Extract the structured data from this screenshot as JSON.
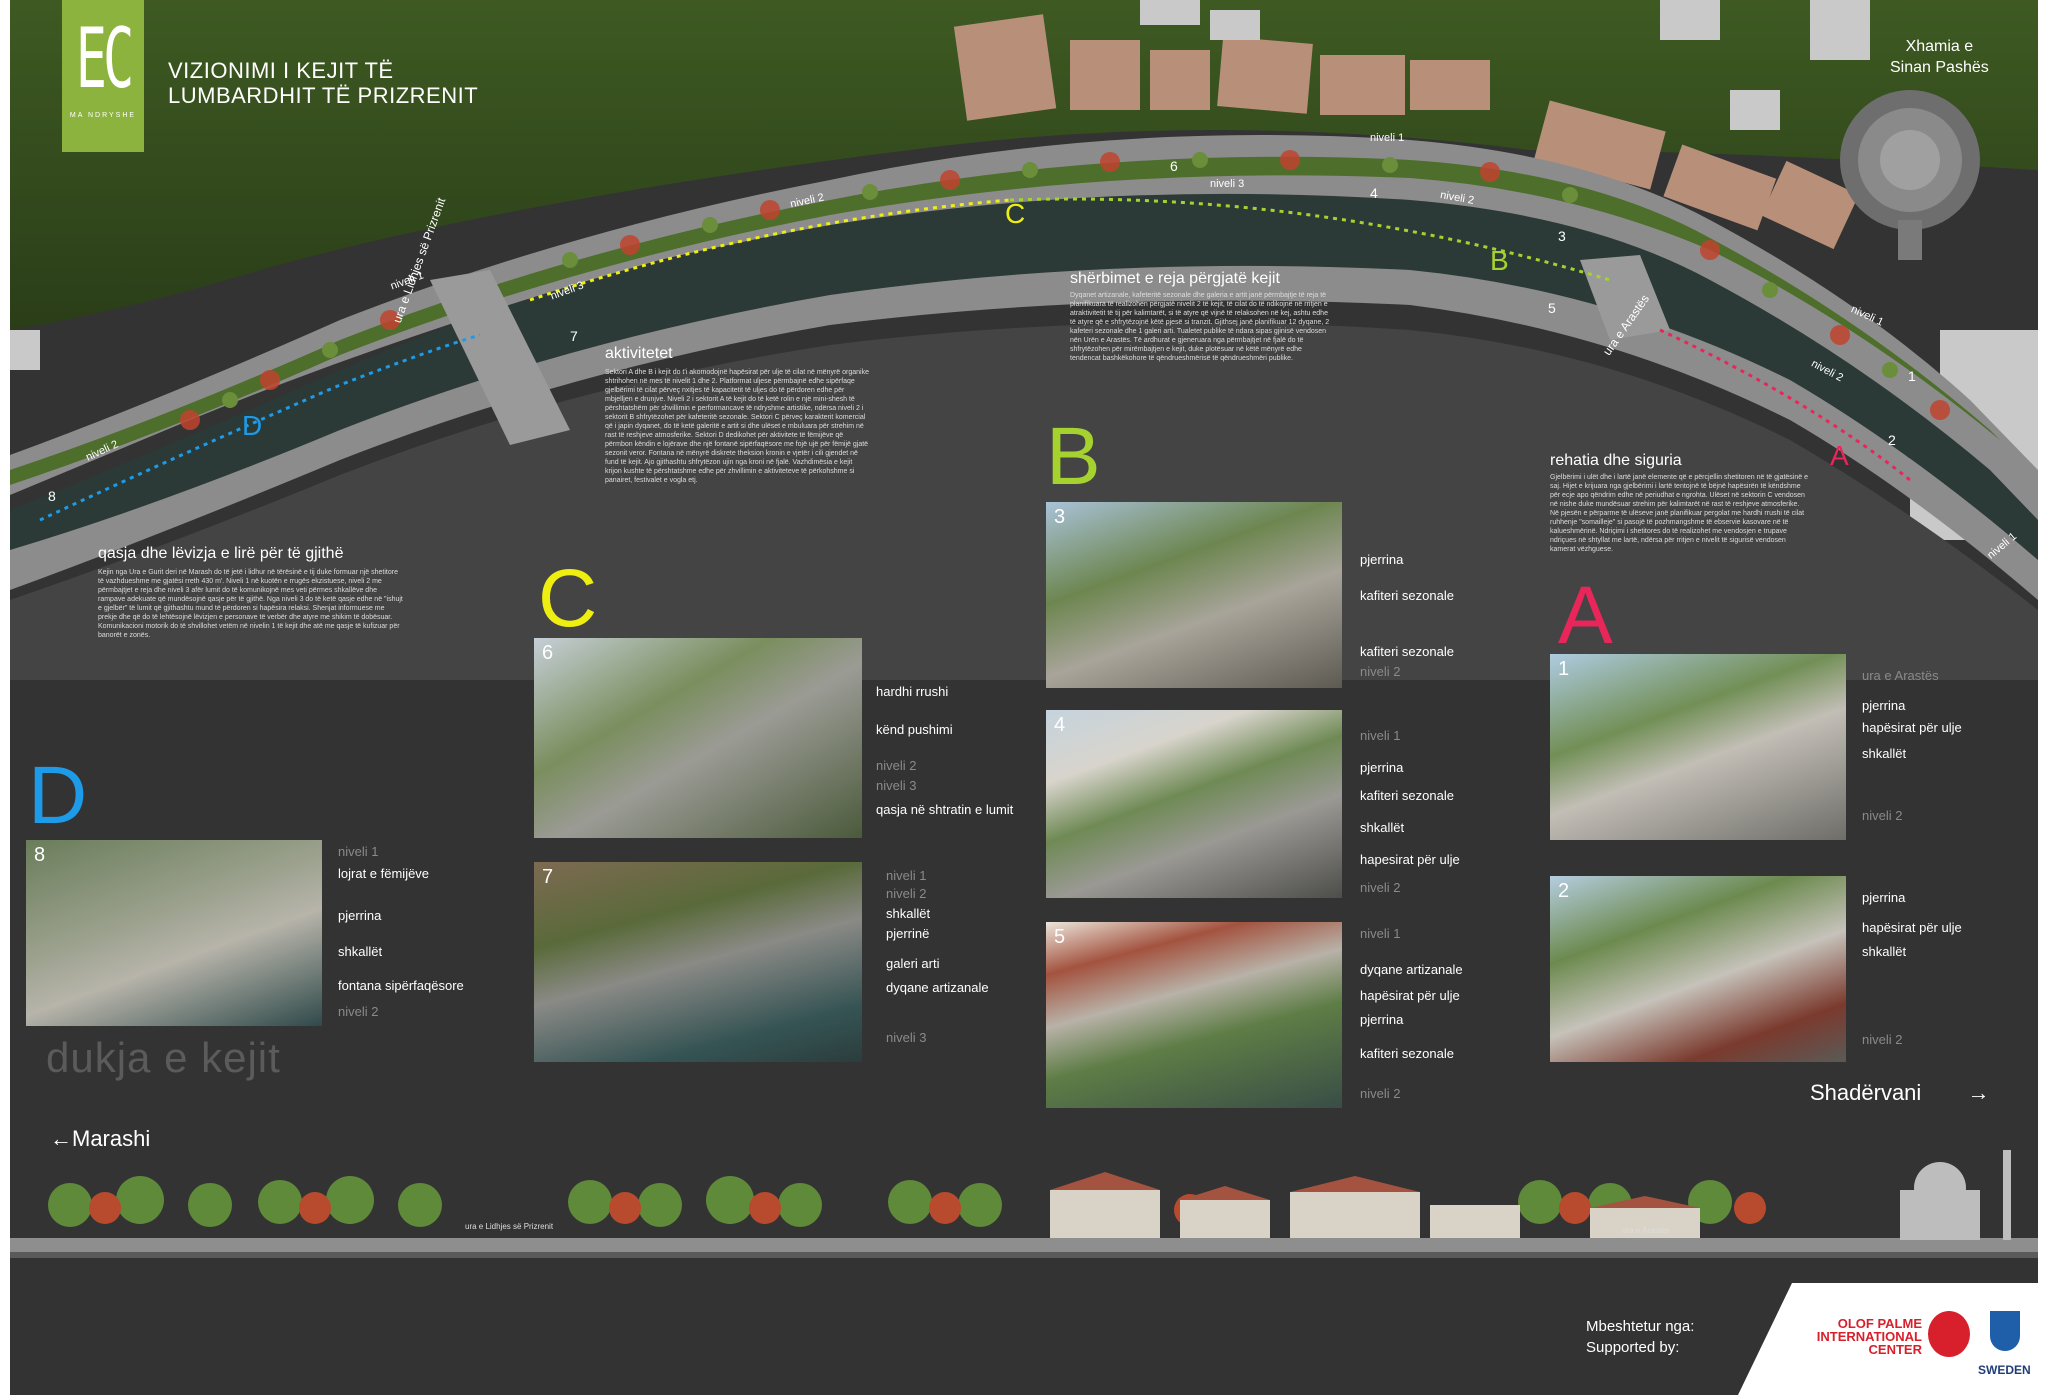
{
  "logo": {
    "mark": "EC",
    "subtitle": "MA NDRYSHE"
  },
  "title": {
    "line1": "VIZIONIMI I KEJIT TË",
    "line2": "LUMBARDHIT TË PRIZRENIT"
  },
  "mosque_label": {
    "line1": "Xhamia e",
    "line2": "Sinan Pashës"
  },
  "plan_labels": {
    "bridge_left": "ura e Lidhjes së Prizrenit",
    "bridge_right": "ura e Arastës",
    "levels": [
      "niveli 1",
      "niveli 2",
      "niveli 3",
      "niveli 2",
      "niveli 1",
      "niveli 3",
      "niveli 2",
      "niveli 1",
      "niveli 2",
      "niveli 1",
      "niveli 2",
      "niveli 1"
    ],
    "view_numbers": [
      "1",
      "2",
      "3",
      "4",
      "5",
      "6",
      "7",
      "8"
    ],
    "sector_letters": [
      "A",
      "B",
      "C",
      "D"
    ]
  },
  "sections": {
    "aktivitetet": {
      "heading": "aktivitetet",
      "body": "Sektori A dhe B i kejit do t'i akomodojnë hapësirat për ulje të cilat në mënyrë organike shtrihohen në mes të nivelit 1 dhe 2. Platformat uljese përmbajnë edhe sipërfaqe gjelbërimi të cilat përveç nxitjes të kapacitetit të uljes do të përdoren edhe për mbjelljen e drunjve. Niveli 2 i sektorit A të kejit do të ketë rolin e një mini-shesh të përshtatshëm për shvillimin e performancave të ndryshme artistike, ndërsa niveli 2 i sektorit B shfrytëzohet për kafeteritë sezonale. Sektori C përveç karakterit komercial që i japin dyqanet, do të ketë galeritë e artit si dhe ulëset e mbuluara për strehim në rast të reshjeve atmosferike. Sektori D dedikohet për aktivitete të fëmijëve që përmbon këndin e lojërave dhe një fontanë sipërfaqësore me fojë ujë për fëmijë gjatë sezonit veror. Fontana në mënyrë diskrete theksion kronin e vjetër i cili gjendet në fund të kejit. Ajo gjithashtu shfrytëzon ujin nga kroni në fjalë. Vazhdimësia e kejit krijon kushte të përshtatshme edhe për zhvillimin e aktiviteteve të përkohshme si panairet, festivalet e vogla etj."
    },
    "sherbimet": {
      "heading": "shërbimet e reja përgjatë kejit",
      "body": "Dyqanet artizanale, kafeteritë sezonale dhe galeria e artit janë përmbajtje të reja të planifikuara të realizohen përgjatë nivelit 2 të kejit, të cilat do të ndikojnë në rritjen e atraktivitetit të tij për kalimtarët, si të atyre që vijnë të relaksohen në kej, ashtu edhe të atyre që e shfrytëzojnë këtë pjesë si tranzit. Gjithsej janë planifikuar 12 dyqane, 2 kafeteri sezonale dhe 1 galeri arti. Tualetet publike të ndara sipas gjinisë vendosen nën Urën e Arastës. Të ardhurat e gjeneruara nga përmbajtjet në fjalë do të shfrytëzohen për mirëmbajtjen e kejit, duke plotësuar në këtë mënyrë edhe tendencat bashkëkohore të qëndrueshmërisë të qëndrueshmëri publike."
    },
    "rehatia": {
      "heading": "rehatia dhe siguria",
      "body": "Gjelbërimi i ulët dhe i lartë janë elemente që e përcjellin shetitoren në të gjatësinë e saj. Hijet e krijuara nga gjelbërimi i lartë tentojnë të bëjnë hapësirën të këndshme për ecje apo qëndrim edhe në periudhat e ngrohta. Ulëset në sektorin C vendosen në nishe duke mundësuar strehim për kalimtarët në rast të reshjeve atmosferike. Në pjesën e përparme të ulëseve janë planifikuar pergolat me hardhi rrushi të cilat ruhhenje \"somailleje\" si pasojë të pozhmangshme të ebservie kasovare në të kalueshmërinë. Ndriçimi i shetitores do të realizohet me vendosjen e trupave ndriçues në shtyllat me lartë, ndërsa për rritjen e nivelit të sigurisë vendosen kamerat vëzhguese."
    },
    "qasja": {
      "heading": "qasja dhe lëvizja e lirë për të gjithë",
      "body": "Kejin nga Ura e Gurit deri në Marash do të jetë i lidhur në tërësinë e tij duke formuar një shetitore të vazhdueshme me gjatësi rreth 430 m'. Niveli 1 në kuotën e rrugës ekzistuese, niveli 2 me përmbajtjet e reja dhe niveli 3 afër lumit do të komunikojnë mes veti përmes shkallëve dhe rampave adekuate që mundësojnë qasje për të gjithë. Nga niveli 3 do të ketë qasje edhe në \"ishujt e gjelbër\" të lumit që gjithashtu mund të përdoren si hapësira relaksi. Shenjat informuese me prekje dhe që do të lehtësojnë lëvizjen e personave të verbër dhe atyre me shikim të dobësuar. Komunikacioni motorik do të shvillohet vetëm në nivelin 1 të kejit dhe atë me qasje të kufizuar për banorët e zonës."
    }
  },
  "groups": {
    "D": {
      "letter": "D",
      "photos": [
        {
          "number": "8",
          "labels": [
            "niveli 1",
            "lojrat e fëmijëve",
            "pjerrina",
            "shkallët",
            "fontana sipërfaqësore",
            "niveli 2"
          ]
        }
      ]
    },
    "C": {
      "letter": "C",
      "photos": [
        {
          "number": "6",
          "labels": [
            "hardhi rrushi",
            "kënd pushimi",
            "niveli 2",
            "niveli 3",
            "qasja në shtratin e lumit"
          ]
        },
        {
          "number": "7",
          "labels": [
            "niveli 1",
            "niveli 2",
            "shkallët",
            "pjerrinë",
            "galeri arti",
            "dyqane artizanale",
            "niveli 3"
          ]
        }
      ]
    },
    "B": {
      "letter": "B",
      "photos": [
        {
          "number": "3",
          "labels": [
            "pjerrina",
            "kafiteri sezonale",
            "kafiteri sezonale",
            "niveli 2"
          ]
        },
        {
          "number": "4",
          "labels": [
            "niveli 1",
            "pjerrina",
            "kafiteri sezonale",
            "shkallët",
            "hapesirat për ulje",
            "niveli 2"
          ]
        },
        {
          "number": "5",
          "labels": [
            "niveli 1",
            "dyqane artizanale",
            "hapësirat për ulje",
            "pjerrina",
            "kafiteri sezonale",
            "niveli 2"
          ]
        }
      ]
    },
    "A": {
      "letter": "A",
      "photos": [
        {
          "number": "1",
          "labels": [
            "ura e Arastës",
            "pjerrina",
            "hapësirat për ulje",
            "shkallët",
            "niveli 2"
          ]
        },
        {
          "number": "2",
          "labels": [
            "pjerrina",
            "hapësirat për ulje",
            "shkallët",
            "niveli 2"
          ]
        }
      ]
    }
  },
  "elevation": {
    "caption": "dukja e kejit",
    "left_label": "Marashi",
    "right_label": "Shadërvani",
    "left_arrow": "←",
    "right_arrow": "→",
    "bridge_left": "ura e Lidhjes së Prizrenit",
    "bridge_right": "ura e Arastës"
  },
  "support": {
    "line1": "Mbeshtetur nga:",
    "line2": "Supported by:",
    "org": "OLOF PALME INTERNATIONAL CENTER",
    "sweden": "SWEDEN"
  },
  "colors": {
    "background": "#333333",
    "A": "#e8265a",
    "B": "#a5d22e",
    "C": "#eeee11",
    "D": "#1e9be8",
    "logo_green": "#8db33f"
  }
}
